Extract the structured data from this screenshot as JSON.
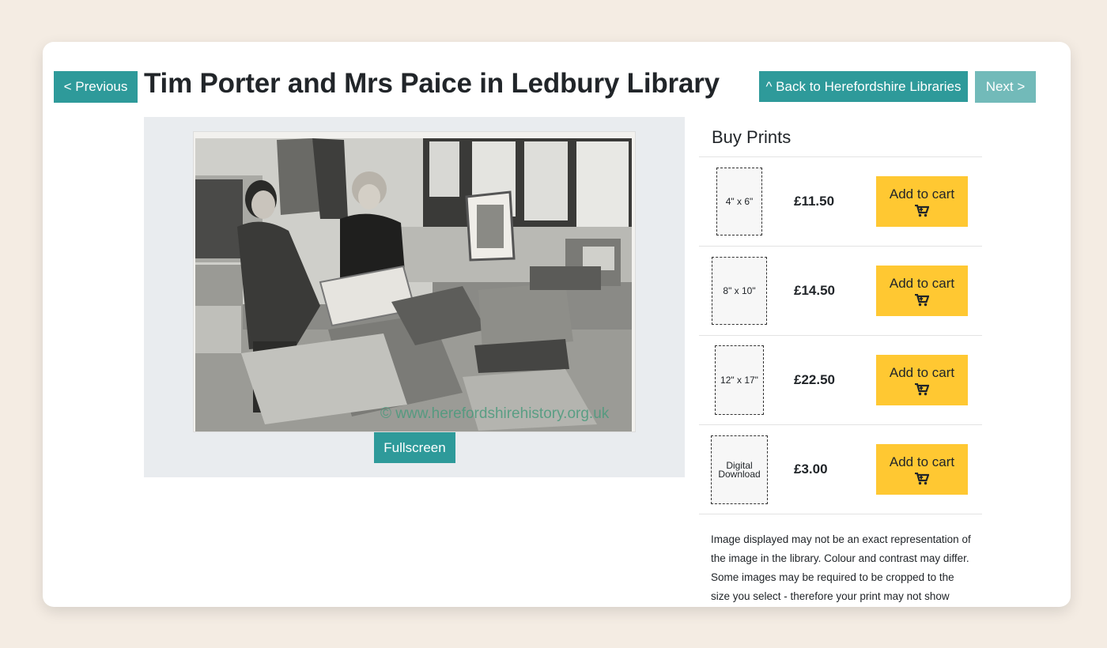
{
  "nav": {
    "previous_label": "< Previous",
    "back_label": "^ Back to Herefordshire Libraries",
    "next_label": "Next >"
  },
  "page": {
    "title": "Tim Porter and Mrs Paice in Ledbury Library"
  },
  "photo": {
    "watermark": "© www.herefordshirehistory.org.uk",
    "fullscreen_label": "Fullscreen"
  },
  "buy_prints": {
    "title": "Buy Prints",
    "add_to_cart_label": "Add to cart",
    "options": [
      {
        "size": "4\" x 6\"",
        "price": "£11.50"
      },
      {
        "size": "8\" x 10\"",
        "price": "£14.50"
      },
      {
        "size": "12\" x 17\"",
        "price": "£22.50"
      },
      {
        "size": "Digital Download",
        "price": "£3.00"
      }
    ]
  },
  "disclaimer": "Image displayed may not be an exact representation of the image in the library. Colour and contrast may differ. Some images may be required to be cropped to the size you select - therefore your print may not show",
  "colors": {
    "teal": "#2e9a9a",
    "teal_light": "#72bab9",
    "cart_yellow": "#ffc832",
    "page_bg": "#f4ece3"
  },
  "icons": [
    "cart-icon"
  ]
}
